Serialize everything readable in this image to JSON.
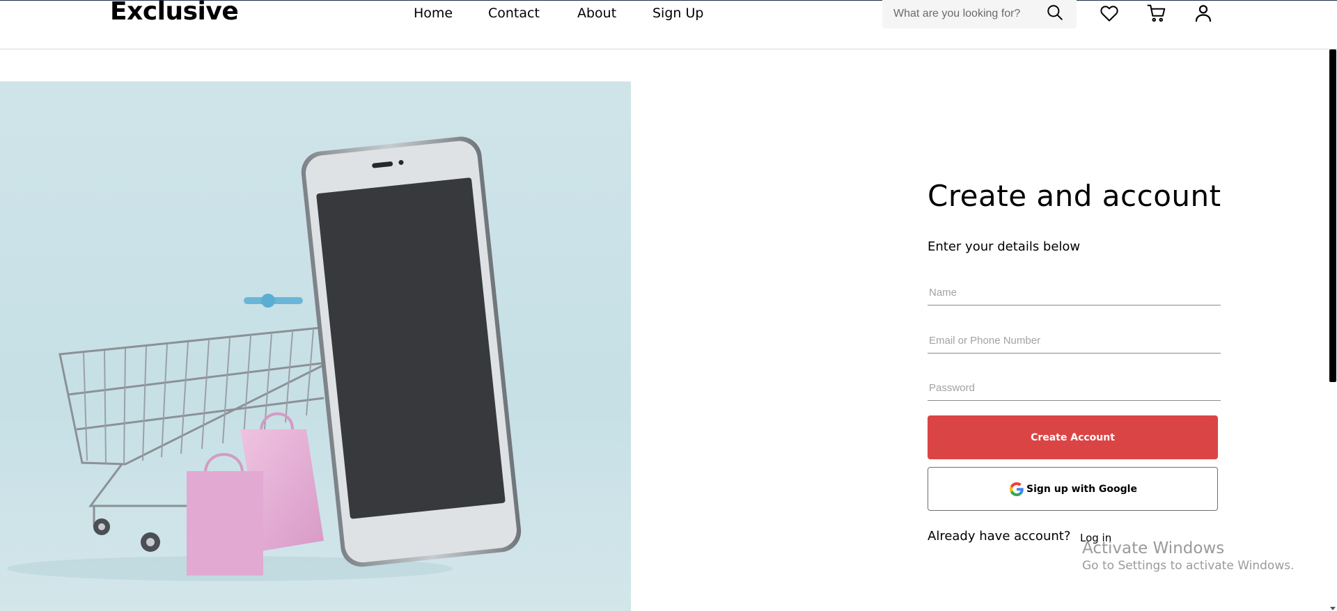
{
  "header": {
    "logo": "Exclusive",
    "nav": [
      "Home",
      "Contact",
      "About",
      "Sign Up"
    ],
    "search": {
      "placeholder": "What are you looking for?",
      "icon": "search-icon"
    },
    "icons": [
      "heart-icon",
      "cart-icon",
      "user-icon"
    ]
  },
  "hero": {
    "image_alt": "shopping-cart-phone-illustration",
    "background_color": "#cbe2e8"
  },
  "form": {
    "title": "Create and account",
    "subtitle": "Enter your details below",
    "name_placeholder": "Name",
    "email_placeholder": "Email or Phone Number",
    "password_placeholder": "Password",
    "create_button": "Create Account",
    "google_button": "Sign up with Google",
    "already_text": "Already have account?",
    "login_link": "Log in"
  },
  "watermark": {
    "line1": "Activate Windows",
    "line2": "Go to Settings to activate Windows."
  },
  "colors": {
    "accent": "#DB4444",
    "text": "#000000",
    "search_bg": "#F5F5F5"
  }
}
